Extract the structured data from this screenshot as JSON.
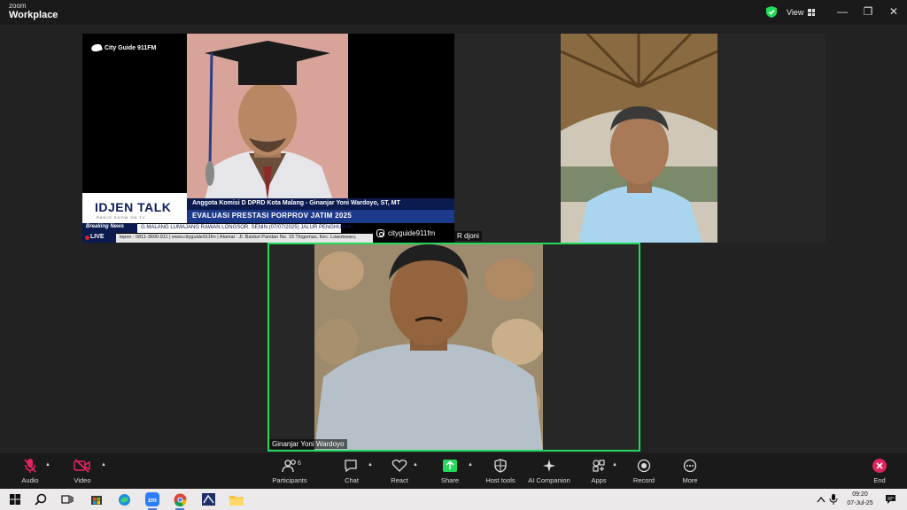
{
  "titlebar": {
    "brand_small": "zoom",
    "brand_large": "Workplace",
    "view_label": "View",
    "minimize": "—",
    "restore": "❐",
    "close": "✕"
  },
  "participants": [
    {
      "channel_logo": "City Guide 911FM",
      "show_title": "IDJEN TALK",
      "show_subtitle": "RADIO SHOW ON TV",
      "guest_caption": "Anggota Komisi D DPRD Kota Malang - Ginanjar Yoni Wardoyo, ST, MT",
      "headline": "EVALUASI PRESTASI PORPROV JATIM 2025",
      "breaking_label": "Breaking News",
      "ticker_text": "G.MALANG LUMAJANG RAWAN LONGSOR.  SENIN (07/07/2025) JALUR PENGHUBUN",
      "live_label": "LIVE",
      "info_text": "lepon : 0811-3600-911 | www.cityguide911fm | Alamat : Jl. Baiduri Pandan No. 16 Tlogomas, Kec. Lowokwaru,",
      "instagram_handle": "cityguide911fm"
    },
    {
      "name": "R djoni"
    },
    {
      "name": "Ginanjar Yoni Wardoyo"
    }
  ],
  "toolbar": {
    "audio": "Audio",
    "video": "Video",
    "participants": "Participants",
    "participants_count": "6",
    "chat": "Chat",
    "react": "React",
    "share": "Share",
    "host_tools": "Host tools",
    "ai_companion": "AI Companion",
    "apps": "Apps",
    "record": "Record",
    "more": "More",
    "end": "End"
  },
  "taskbar": {
    "zoom_label": "zm",
    "time": "09:20",
    "date": "07-Jul-25"
  },
  "colors": {
    "active_speaker_border": "#23d959",
    "share_green": "#23d959",
    "end_red": "#e0245e",
    "mute_red": "#e0245e"
  }
}
